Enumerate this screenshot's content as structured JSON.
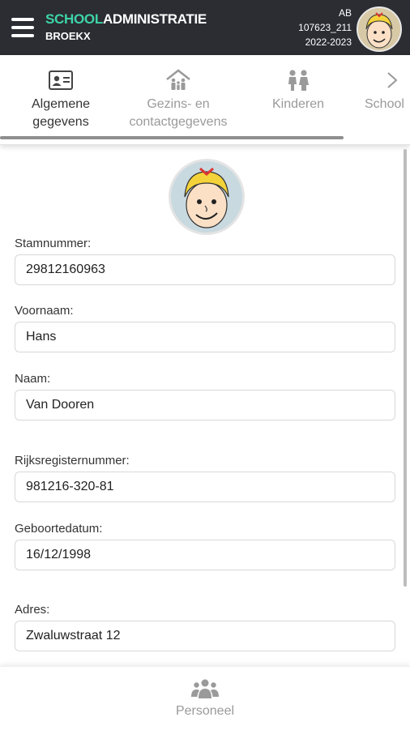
{
  "header": {
    "brand_part1": "SCHOOL",
    "brand_part2": "ADMINISTRATIE",
    "subtitle": "BROEKX",
    "user_initials": "AB",
    "user_id": "107623_211",
    "school_year": "2022-2023",
    "accent_color": "#3dd4a8",
    "background_color": "#2b2d33"
  },
  "tabs": [
    {
      "label_line1": "Algemene",
      "label_line2": "gegevens",
      "icon": "id-card-icon",
      "active": true
    },
    {
      "label_line1": "Gezins- en",
      "label_line2": "contactgegevens",
      "icon": "family-house-icon",
      "active": false
    },
    {
      "label_line1": "Kinderen",
      "label_line2": "",
      "icon": "children-icon",
      "active": false
    },
    {
      "label_line1": "School",
      "label_line2": "",
      "icon": "school-icon",
      "active": false
    }
  ],
  "form": {
    "fields": [
      {
        "label": "Stamnummer:",
        "value": "29812160963"
      },
      {
        "label": "Voornaam:",
        "value": "Hans"
      },
      {
        "label": "Naam:",
        "value": "Van Dooren"
      },
      {
        "label": "Rijksregisternummer:",
        "value": "981216-320-81"
      },
      {
        "label": "Geboortedatum:",
        "value": "16/12/1998"
      },
      {
        "label": "Adres:",
        "value": "Zwaluwstraat 12"
      }
    ]
  },
  "bottom_nav": {
    "label": "Personeel",
    "icon": "people-icon"
  }
}
